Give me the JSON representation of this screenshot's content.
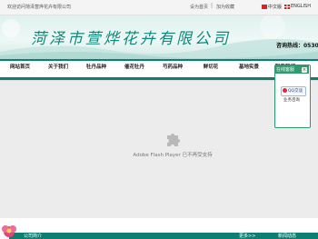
{
  "topbar": {
    "welcome": "欢迎访问菏泽萱烨花卉有限公司",
    "set_home": "设为首页",
    "separator": "|",
    "add_favorite": "加为收藏",
    "lang_cn": "中文版",
    "lang_en": "ENGLISH"
  },
  "banner": {
    "company_name": "菏泽市萱烨花卉有限公司",
    "hotline": "咨询热线：0530"
  },
  "nav": {
    "items": [
      "网站首页",
      "关于我们",
      "牡丹品种",
      "催花牡丹",
      "芍药品种",
      "鲜切花",
      "基地实景",
      "联系我们"
    ]
  },
  "flash": {
    "message": "Adobe Flash Player 已不再受支持"
  },
  "widget": {
    "title": "在线客服",
    "close": "×",
    "qq_label": "QQ交谈",
    "subtitle": "业务咨询"
  },
  "bottom": {
    "left_label": "公司简介",
    "mid_label": "更多>>",
    "right_label": "新闻动态"
  },
  "colors": {
    "brand_green": "#0d7f72",
    "widget_green": "#2e9a6e"
  }
}
